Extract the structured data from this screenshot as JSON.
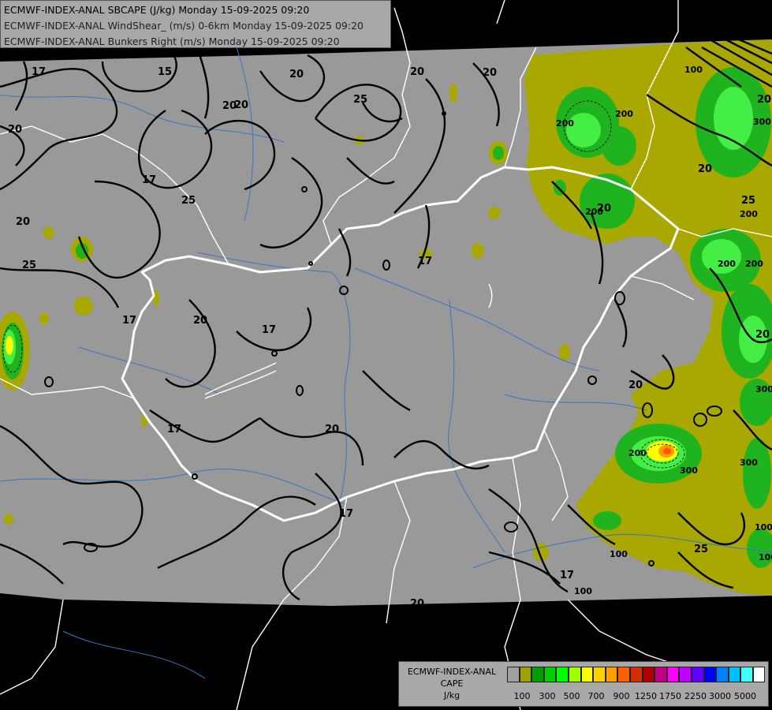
{
  "titles": [
    "ECMWF-INDEX-ANAL SBCAPE (J/kg) Monday 15-09-2025 09:20",
    "ECMWF-INDEX-ANAL WindShear_ (m/s) 0-6km Monday 15-09-2025 09:20",
    "ECMWF-INDEX-ANAL Bunkers Right (m/s) Monday 15-09-2025 09:20"
  ],
  "legend": {
    "line1": "ECMWF-INDEX-ANAL",
    "line2": "CAPE",
    "line3": "J/kg",
    "colors": [
      "#a0a0a0",
      "#a0a000",
      "#00a000",
      "#00d000",
      "#00ff00",
      "#a0ff00",
      "#ffff00",
      "#ffd000",
      "#ffa000",
      "#ff6000",
      "#d03000",
      "#b00000",
      "#c00080",
      "#ff00ff",
      "#c000ff",
      "#6000ff",
      "#0000ff",
      "#0080ff",
      "#00c0ff",
      "#40ffff",
      "#ffffff"
    ],
    "tick_labels": [
      "100",
      "300",
      "500",
      "700",
      "900",
      "1250",
      "1750",
      "2250",
      "3000",
      "5000"
    ]
  },
  "contour_labels": {
    "shear": [
      "17",
      "15",
      "20",
      "17",
      "20",
      "25",
      "17",
      "20",
      "20",
      "17",
      "25",
      "17",
      "20",
      "20",
      "17",
      "20",
      "17",
      "20",
      "20",
      "25",
      "20",
      "25",
      "20",
      "20",
      "17",
      "20",
      "20",
      "25",
      "20"
    ],
    "cape": [
      "100",
      "200",
      "200",
      "300",
      "200",
      "200",
      "200",
      "300",
      "200",
      "100",
      "100",
      "100",
      "100",
      "200",
      "300",
      "300"
    ]
  },
  "colors": {
    "background_gray": "#999999",
    "outside_domain": "#000000",
    "cape_100": "#a8a800",
    "cape_200": "#2ea82e",
    "cape_300": "#32cd32",
    "cape_high": "#ff6a00",
    "border": "#ffffff",
    "river": "#3a74c8",
    "contour": "#000000"
  }
}
